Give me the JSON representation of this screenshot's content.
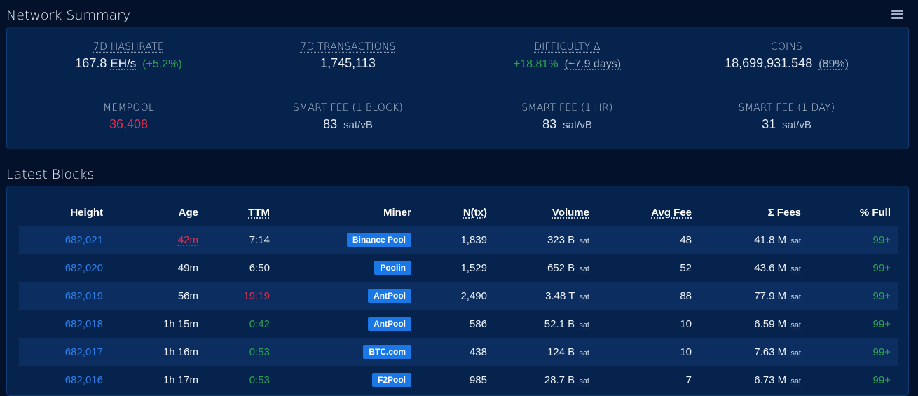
{
  "network_summary": {
    "title": "Network Summary",
    "menu_icon": "list-icon",
    "hashrate": {
      "label": "7D HASHRATE",
      "value": "167.8",
      "unit": "EH/s",
      "change": "(+5.2%)"
    },
    "transactions": {
      "label": "7D TRANSACTIONS",
      "value": "1,745,113"
    },
    "difficulty": {
      "label": "DIFFICULTY Δ",
      "value": "+18.81%",
      "eta": "(~7.9 days)"
    },
    "coins": {
      "label": "COINS",
      "value": "18,699,931.548",
      "pct": "(89%)"
    },
    "mempool": {
      "label": "MEMPOOL",
      "value": "36,408"
    },
    "fee_block": {
      "label": "SMART FEE (1 BLOCK)",
      "value": "83",
      "unit": "sat/vB"
    },
    "fee_hr": {
      "label": "SMART FEE (1 HR)",
      "value": "83",
      "unit": "sat/vB"
    },
    "fee_day": {
      "label": "SMART FEE (1 DAY)",
      "value": "31",
      "unit": "sat/vB"
    }
  },
  "latest_blocks": {
    "title": "Latest Blocks",
    "columns": [
      "Height",
      "Age",
      "TTM",
      "Miner",
      "N(tx)",
      "Volume",
      "Avg Fee",
      "Σ Fees",
      "% Full"
    ],
    "rows": [
      {
        "height": "682,021",
        "age": "42m",
        "ttm": "7:14",
        "miner": "Binance Pool",
        "ntx": "1,839",
        "volume": "323 B",
        "avg_fee": "48",
        "fees": "41.8 M",
        "full": "99+"
      },
      {
        "height": "682,020",
        "age": "49m",
        "ttm": "6:50",
        "miner": "Poolin",
        "ntx": "1,529",
        "volume": "652 B",
        "avg_fee": "52",
        "fees": "43.6 M",
        "full": "99+"
      },
      {
        "height": "682,019",
        "age": "56m",
        "ttm": "19:19",
        "miner": "AntPool",
        "ntx": "2,490",
        "volume": "3.48 T",
        "avg_fee": "88",
        "fees": "77.9 M",
        "full": "99+"
      },
      {
        "height": "682,018",
        "age": "1h 15m",
        "ttm": "0:42",
        "miner": "AntPool",
        "ntx": "586",
        "volume": "52.1 B",
        "avg_fee": "10",
        "fees": "6.59 M",
        "full": "99+"
      },
      {
        "height": "682,017",
        "age": "1h 16m",
        "ttm": "0:53",
        "miner": "BTC.com",
        "ntx": "438",
        "volume": "124 B",
        "avg_fee": "10",
        "fees": "7.63 M",
        "full": "99+"
      },
      {
        "height": "682,016",
        "age": "1h 17m",
        "ttm": "0:53",
        "miner": "F2Pool",
        "ntx": "985",
        "volume": "28.7 B",
        "avg_fee": "7",
        "fees": "6.73 M",
        "full": "99+"
      }
    ],
    "sat_unit": "sat"
  },
  "colors": {
    "background": "#03112a",
    "card": "#06234d",
    "link": "#2f7fe8",
    "positive": "#2fa353",
    "negative": "#e0304f",
    "badge": "#1977e6"
  }
}
